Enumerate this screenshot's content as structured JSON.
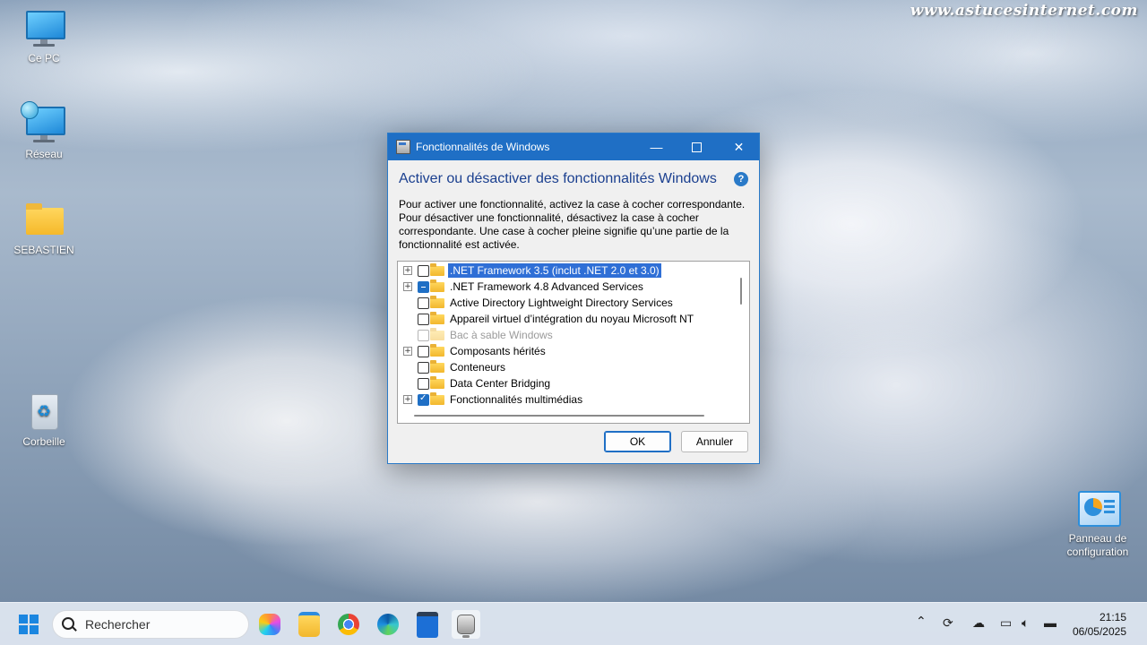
{
  "watermark": "www.astucesinternet.com",
  "desktop": {
    "icons": [
      {
        "label": "Ce PC",
        "icon": "computer-icon"
      },
      {
        "label": "Réseau",
        "icon": "network-icon"
      },
      {
        "label": "SEBASTIEN",
        "icon": "folder-icon"
      },
      {
        "label": "Corbeille",
        "icon": "recycle-bin-icon"
      },
      {
        "label": "Panneau de configuration",
        "icon": "control-panel-icon"
      }
    ]
  },
  "dialog": {
    "title": "Fonctionnalités de Windows",
    "heading": "Activer ou désactiver des fonctionnalités Windows",
    "help": "?",
    "description": "Pour activer une fonctionnalité, activez la case à cocher correspondante. Pour désactiver une fonctionnalité, désactivez la case à cocher correspondante. Une case à cocher pleine signifie qu’une partie de la fonctionnalité est activée.",
    "features": [
      {
        "label": ".NET Framework 3.5 (inclut .NET 2.0 et 3.0)",
        "expandable": true,
        "state": "unchecked",
        "selected": true
      },
      {
        "label": ".NET Framework 4.8 Advanced Services",
        "expandable": true,
        "state": "partial"
      },
      {
        "label": "Active Directory Lightweight Directory Services",
        "expandable": false,
        "state": "unchecked"
      },
      {
        "label": "Appareil virtuel d’intégration du noyau Microsoft NT",
        "expandable": false,
        "state": "unchecked"
      },
      {
        "label": "Bac à sable Windows",
        "expandable": false,
        "state": "disabled"
      },
      {
        "label": "Composants hérités",
        "expandable": true,
        "state": "unchecked"
      },
      {
        "label": "Conteneurs",
        "expandable": false,
        "state": "unchecked"
      },
      {
        "label": "Data Center Bridging",
        "expandable": false,
        "state": "unchecked"
      },
      {
        "label": "Fonctionnalités multimédias",
        "expandable": true,
        "state": "checked"
      }
    ],
    "ok_label": "OK",
    "cancel_label": "Annuler"
  },
  "taskbar": {
    "search_placeholder": "Rechercher",
    "apps": [
      "copilot-icon",
      "file-explorer-icon",
      "chrome-icon",
      "edge-icon",
      "store-icon",
      "windows-features-icon"
    ],
    "tray_icons": [
      "chevron-up-icon",
      "sync-icon",
      "cloud-off-icon",
      "network-icon",
      "volume-icon",
      "battery-icon"
    ],
    "time": "21:15",
    "date": "06/05/2025"
  },
  "colors": {
    "accent": "#1f6fc5",
    "selection": "#2f6fd6",
    "heading": "#1a3f8f"
  }
}
